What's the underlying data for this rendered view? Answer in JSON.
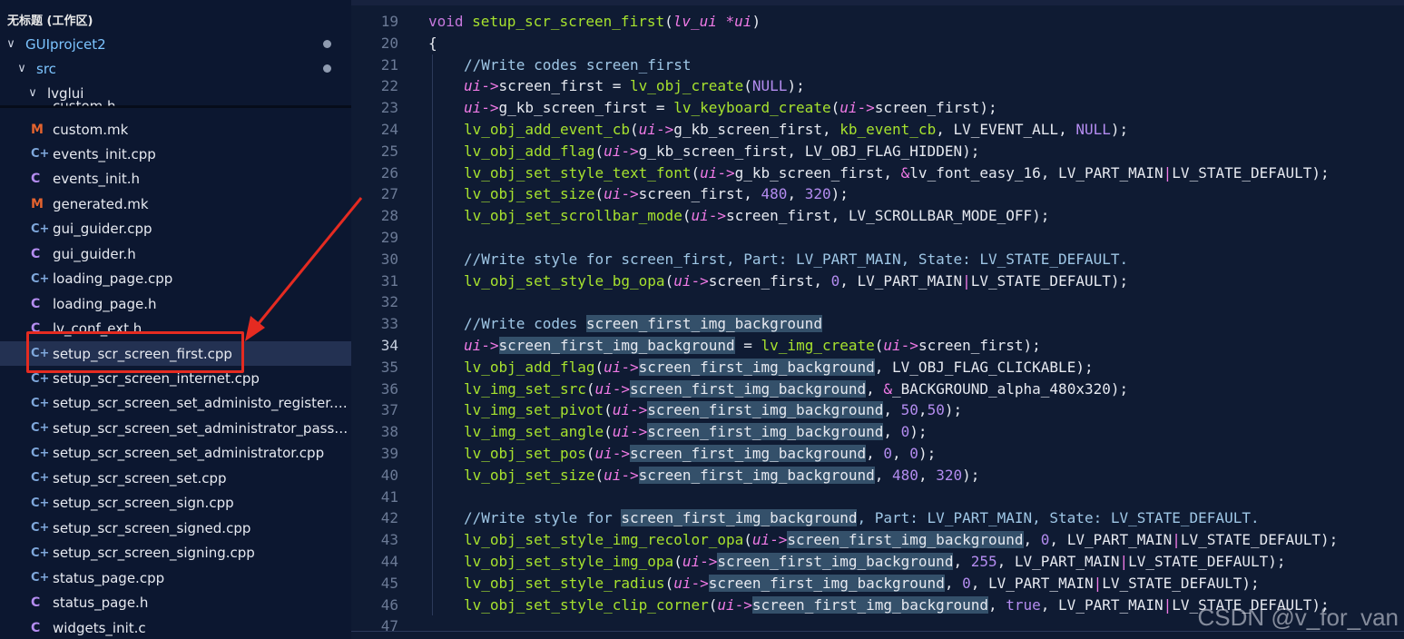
{
  "explorer": {
    "workspace_title": "无标题 (工作区)",
    "folders": [
      {
        "label": "GUIprojcet2",
        "indent": 1
      },
      {
        "label": "src",
        "indent": 2
      },
      {
        "label": "lvglui",
        "indent": 3
      }
    ],
    "partial_top_file": "custom.h",
    "files": [
      {
        "name": "custom.mk",
        "icon": "makefile-icon",
        "type": "mk"
      },
      {
        "name": "events_init.cpp",
        "icon": "cpp-file-icon",
        "type": "cpp"
      },
      {
        "name": "events_init.h",
        "icon": "c-header-icon",
        "type": "c"
      },
      {
        "name": "generated.mk",
        "icon": "makefile-icon",
        "type": "mk"
      },
      {
        "name": "gui_guider.cpp",
        "icon": "cpp-file-icon",
        "type": "cpp"
      },
      {
        "name": "gui_guider.h",
        "icon": "c-header-icon",
        "type": "c"
      },
      {
        "name": "loading_page.cpp",
        "icon": "cpp-file-icon",
        "type": "cpp"
      },
      {
        "name": "loading_page.h",
        "icon": "c-header-icon",
        "type": "c"
      },
      {
        "name": "lv_conf_ext.h",
        "icon": "c-header-icon",
        "type": "c"
      },
      {
        "name": "setup_scr_screen_first.cpp",
        "icon": "cpp-file-icon",
        "type": "cpp",
        "selected": true
      },
      {
        "name": "setup_scr_screen_internet.cpp",
        "icon": "cpp-file-icon",
        "type": "cpp"
      },
      {
        "name": "setup_scr_screen_set_administo_register.cpp",
        "icon": "cpp-file-icon",
        "type": "cpp"
      },
      {
        "name": "setup_scr_screen_set_administrator_passwor...",
        "icon": "cpp-file-icon",
        "type": "cpp"
      },
      {
        "name": "setup_scr_screen_set_administrator.cpp",
        "icon": "cpp-file-icon",
        "type": "cpp"
      },
      {
        "name": "setup_scr_screen_set.cpp",
        "icon": "cpp-file-icon",
        "type": "cpp"
      },
      {
        "name": "setup_scr_screen_sign.cpp",
        "icon": "cpp-file-icon",
        "type": "cpp"
      },
      {
        "name": "setup_scr_screen_signed.cpp",
        "icon": "cpp-file-icon",
        "type": "cpp"
      },
      {
        "name": "setup_scr_screen_signing.cpp",
        "icon": "cpp-file-icon",
        "type": "cpp"
      },
      {
        "name": "status_page.cpp",
        "icon": "cpp-file-icon",
        "type": "cpp"
      },
      {
        "name": "status_page.h",
        "icon": "c-header-icon",
        "type": "c"
      },
      {
        "name": "widgets_init.c",
        "icon": "c-header-icon",
        "type": "c"
      }
    ]
  },
  "colors": {
    "annotation_red": "#e52b21",
    "keyword": "#c678dd",
    "function": "#a7e22e",
    "param": "#f07ae6",
    "number": "#b48cf0",
    "comment": "#9fc7e6",
    "highlight": "#34506a"
  },
  "editor": {
    "active_line": 34,
    "lines": [
      {
        "n": 19,
        "indent": 0,
        "tokens": [
          [
            "kw",
            "void "
          ],
          [
            "fn",
            "setup_scr_screen_first"
          ],
          [
            "punc",
            "("
          ],
          [
            "param",
            "lv_ui "
          ],
          [
            "op",
            "*"
          ],
          [
            "param",
            "ui"
          ],
          [
            "punc",
            ")"
          ]
        ]
      },
      {
        "n": 20,
        "indent": 0,
        "tokens": [
          [
            "punc",
            "{"
          ]
        ]
      },
      {
        "n": 21,
        "indent": 1,
        "tokens": [
          [
            "comment",
            "//Write codes screen_first"
          ]
        ]
      },
      {
        "n": 22,
        "indent": 1,
        "tokens": [
          [
            "param",
            "ui"
          ],
          [
            "op",
            "->"
          ],
          [
            "ident",
            "screen_first = "
          ],
          [
            "fn",
            "lv_obj_create"
          ],
          [
            "punc",
            "("
          ],
          [
            "lit",
            "NULL"
          ],
          [
            "punc",
            ");"
          ]
        ]
      },
      {
        "n": 23,
        "indent": 1,
        "tokens": [
          [
            "param",
            "ui"
          ],
          [
            "op",
            "->"
          ],
          [
            "ident",
            "g_kb_screen_first = "
          ],
          [
            "fn",
            "lv_keyboard_create"
          ],
          [
            "punc",
            "("
          ],
          [
            "param",
            "ui"
          ],
          [
            "op",
            "->"
          ],
          [
            "ident",
            "screen_first"
          ],
          [
            "punc",
            ");"
          ]
        ]
      },
      {
        "n": 24,
        "indent": 1,
        "tokens": [
          [
            "fn",
            "lv_obj_add_event_cb"
          ],
          [
            "punc",
            "("
          ],
          [
            "param",
            "ui"
          ],
          [
            "op",
            "->"
          ],
          [
            "ident",
            "g_kb_screen_first, "
          ],
          [
            "fn",
            "kb_event_cb"
          ],
          [
            "punc",
            ", "
          ],
          [
            "const",
            "LV_EVENT_ALL"
          ],
          [
            "punc",
            ", "
          ],
          [
            "lit",
            "NULL"
          ],
          [
            "punc",
            ");"
          ]
        ]
      },
      {
        "n": 25,
        "indent": 1,
        "tokens": [
          [
            "fn",
            "lv_obj_add_flag"
          ],
          [
            "punc",
            "("
          ],
          [
            "param",
            "ui"
          ],
          [
            "op",
            "->"
          ],
          [
            "ident",
            "g_kb_screen_first, LV_OBJ_FLAG_HIDDEN"
          ],
          [
            "punc",
            ");"
          ]
        ]
      },
      {
        "n": 26,
        "indent": 1,
        "tokens": [
          [
            "fn",
            "lv_obj_set_style_text_font"
          ],
          [
            "punc",
            "("
          ],
          [
            "param",
            "ui"
          ],
          [
            "op",
            "->"
          ],
          [
            "ident",
            "g_kb_screen_first, "
          ],
          [
            "op",
            "&"
          ],
          [
            "ident",
            "lv_font_easy_16, LV_PART_MAIN"
          ],
          [
            "op",
            "|"
          ],
          [
            "ident",
            "LV_STATE_DEFAULT"
          ],
          [
            "punc",
            ");"
          ]
        ]
      },
      {
        "n": 27,
        "indent": 1,
        "tokens": [
          [
            "fn",
            "lv_obj_set_size"
          ],
          [
            "punc",
            "("
          ],
          [
            "param",
            "ui"
          ],
          [
            "op",
            "->"
          ],
          [
            "ident",
            "screen_first, "
          ],
          [
            "num",
            "480"
          ],
          [
            "punc",
            ", "
          ],
          [
            "num",
            "320"
          ],
          [
            "punc",
            ");"
          ]
        ]
      },
      {
        "n": 28,
        "indent": 1,
        "tokens": [
          [
            "fn",
            "lv_obj_set_scrollbar_mode"
          ],
          [
            "punc",
            "("
          ],
          [
            "param",
            "ui"
          ],
          [
            "op",
            "->"
          ],
          [
            "ident",
            "screen_first, LV_SCROLLBAR_MODE_OFF"
          ],
          [
            "punc",
            ");"
          ]
        ]
      },
      {
        "n": 29,
        "indent": 1,
        "tokens": []
      },
      {
        "n": 30,
        "indent": 1,
        "tokens": [
          [
            "comment",
            "//Write style for screen_first, Part: LV_PART_MAIN, State: LV_STATE_DEFAULT."
          ]
        ]
      },
      {
        "n": 31,
        "indent": 1,
        "tokens": [
          [
            "fn",
            "lv_obj_set_style_bg_opa"
          ],
          [
            "punc",
            "("
          ],
          [
            "param",
            "ui"
          ],
          [
            "op",
            "->"
          ],
          [
            "ident",
            "screen_first, "
          ],
          [
            "num",
            "0"
          ],
          [
            "punc",
            ", "
          ],
          [
            "ident",
            "LV_PART_MAIN"
          ],
          [
            "op",
            "|"
          ],
          [
            "ident",
            "LV_STATE_DEFAULT"
          ],
          [
            "punc",
            ");"
          ]
        ]
      },
      {
        "n": 32,
        "indent": 1,
        "tokens": []
      },
      {
        "n": 33,
        "indent": 1,
        "tokens": [
          [
            "comment",
            "//Write codes "
          ],
          [
            "hl",
            "screen_first_img_background"
          ]
        ]
      },
      {
        "n": 34,
        "indent": 1,
        "tokens": [
          [
            "param",
            "ui"
          ],
          [
            "op",
            "->"
          ],
          [
            "hl",
            "screen_first_img_background"
          ],
          [
            "ident",
            " = "
          ],
          [
            "fn",
            "lv_img_create"
          ],
          [
            "punc",
            "("
          ],
          [
            "param",
            "ui"
          ],
          [
            "op",
            "->"
          ],
          [
            "ident",
            "screen_first"
          ],
          [
            "punc",
            ");"
          ]
        ]
      },
      {
        "n": 35,
        "indent": 1,
        "tokens": [
          [
            "fn",
            "lv_obj_add_flag"
          ],
          [
            "punc",
            "("
          ],
          [
            "param",
            "ui"
          ],
          [
            "op",
            "->"
          ],
          [
            "hl",
            "screen_first_img_background"
          ],
          [
            "ident",
            ", LV_OBJ_FLAG_CLICKABLE"
          ],
          [
            "punc",
            ");"
          ]
        ]
      },
      {
        "n": 36,
        "indent": 1,
        "tokens": [
          [
            "fn",
            "lv_img_set_src"
          ],
          [
            "punc",
            "("
          ],
          [
            "param",
            "ui"
          ],
          [
            "op",
            "->"
          ],
          [
            "hl",
            "screen_first_img_background"
          ],
          [
            "ident",
            ", "
          ],
          [
            "op",
            "&"
          ],
          [
            "ident",
            "_BACKGROUND_alpha_480x320"
          ],
          [
            "punc",
            ");"
          ]
        ]
      },
      {
        "n": 37,
        "indent": 1,
        "tokens": [
          [
            "fn",
            "lv_img_set_pivot"
          ],
          [
            "punc",
            "("
          ],
          [
            "param",
            "ui"
          ],
          [
            "op",
            "->"
          ],
          [
            "hl",
            "screen_first_img_background"
          ],
          [
            "ident",
            ", "
          ],
          [
            "num",
            "50"
          ],
          [
            "punc",
            ","
          ],
          [
            "num",
            "50"
          ],
          [
            "punc",
            ");"
          ]
        ]
      },
      {
        "n": 38,
        "indent": 1,
        "tokens": [
          [
            "fn",
            "lv_img_set_angle"
          ],
          [
            "punc",
            "("
          ],
          [
            "param",
            "ui"
          ],
          [
            "op",
            "->"
          ],
          [
            "hl",
            "screen_first_img_background"
          ],
          [
            "ident",
            ", "
          ],
          [
            "num",
            "0"
          ],
          [
            "punc",
            ");"
          ]
        ]
      },
      {
        "n": 39,
        "indent": 1,
        "tokens": [
          [
            "fn",
            "lv_obj_set_pos"
          ],
          [
            "punc",
            "("
          ],
          [
            "param",
            "ui"
          ],
          [
            "op",
            "->"
          ],
          [
            "hl",
            "screen_first_img_background"
          ],
          [
            "ident",
            ", "
          ],
          [
            "num",
            "0"
          ],
          [
            "punc",
            ", "
          ],
          [
            "num",
            "0"
          ],
          [
            "punc",
            ");"
          ]
        ]
      },
      {
        "n": 40,
        "indent": 1,
        "tokens": [
          [
            "fn",
            "lv_obj_set_size"
          ],
          [
            "punc",
            "("
          ],
          [
            "param",
            "ui"
          ],
          [
            "op",
            "->"
          ],
          [
            "hl",
            "screen_first_img_background"
          ],
          [
            "ident",
            ", "
          ],
          [
            "num",
            "480"
          ],
          [
            "punc",
            ", "
          ],
          [
            "num",
            "320"
          ],
          [
            "punc",
            ");"
          ]
        ]
      },
      {
        "n": 41,
        "indent": 1,
        "tokens": []
      },
      {
        "n": 42,
        "indent": 1,
        "tokens": [
          [
            "comment",
            "//Write style for "
          ],
          [
            "hl",
            "screen_first_img_background"
          ],
          [
            "comment",
            ", Part: LV_PART_MAIN, State: LV_STATE_DEFAULT."
          ]
        ]
      },
      {
        "n": 43,
        "indent": 1,
        "tokens": [
          [
            "fn",
            "lv_obj_set_style_img_recolor_opa"
          ],
          [
            "punc",
            "("
          ],
          [
            "param",
            "ui"
          ],
          [
            "op",
            "->"
          ],
          [
            "hl",
            "screen_first_img_background"
          ],
          [
            "ident",
            ", "
          ],
          [
            "num",
            "0"
          ],
          [
            "punc",
            ", "
          ],
          [
            "ident",
            "LV_PART_MAIN"
          ],
          [
            "op",
            "|"
          ],
          [
            "ident",
            "LV_STATE_DEFAULT"
          ],
          [
            "punc",
            ");"
          ]
        ]
      },
      {
        "n": 44,
        "indent": 1,
        "tokens": [
          [
            "fn",
            "lv_obj_set_style_img_opa"
          ],
          [
            "punc",
            "("
          ],
          [
            "param",
            "ui"
          ],
          [
            "op",
            "->"
          ],
          [
            "hl",
            "screen_first_img_background"
          ],
          [
            "ident",
            ", "
          ],
          [
            "num",
            "255"
          ],
          [
            "punc",
            ", "
          ],
          [
            "ident",
            "LV_PART_MAIN"
          ],
          [
            "op",
            "|"
          ],
          [
            "ident",
            "LV_STATE_DEFAULT"
          ],
          [
            "punc",
            ");"
          ]
        ]
      },
      {
        "n": 45,
        "indent": 1,
        "tokens": [
          [
            "fn",
            "lv_obj_set_style_radius"
          ],
          [
            "punc",
            "("
          ],
          [
            "param",
            "ui"
          ],
          [
            "op",
            "->"
          ],
          [
            "hl",
            "screen_first_img_background"
          ],
          [
            "ident",
            ", "
          ],
          [
            "num",
            "0"
          ],
          [
            "punc",
            ", "
          ],
          [
            "ident",
            "LV_PART_MAIN"
          ],
          [
            "op",
            "|"
          ],
          [
            "ident",
            "LV_STATE_DEFAULT"
          ],
          [
            "punc",
            ");"
          ]
        ]
      },
      {
        "n": 46,
        "indent": 1,
        "tokens": [
          [
            "fn",
            "lv_obj_set_style_clip_corner"
          ],
          [
            "punc",
            "("
          ],
          [
            "param",
            "ui"
          ],
          [
            "op",
            "->"
          ],
          [
            "hl",
            "screen_first_img_background"
          ],
          [
            "ident",
            ", "
          ],
          [
            "lit",
            "true"
          ],
          [
            "punc",
            ", "
          ],
          [
            "ident",
            "LV_PART_MAIN"
          ],
          [
            "op",
            "|"
          ],
          [
            "ident",
            "LV_STATE_DEFAULT"
          ],
          [
            "punc",
            ");"
          ]
        ]
      },
      {
        "n": 47,
        "indent": 0,
        "tokens": []
      }
    ]
  },
  "watermark": "CSDN @v_for_van"
}
